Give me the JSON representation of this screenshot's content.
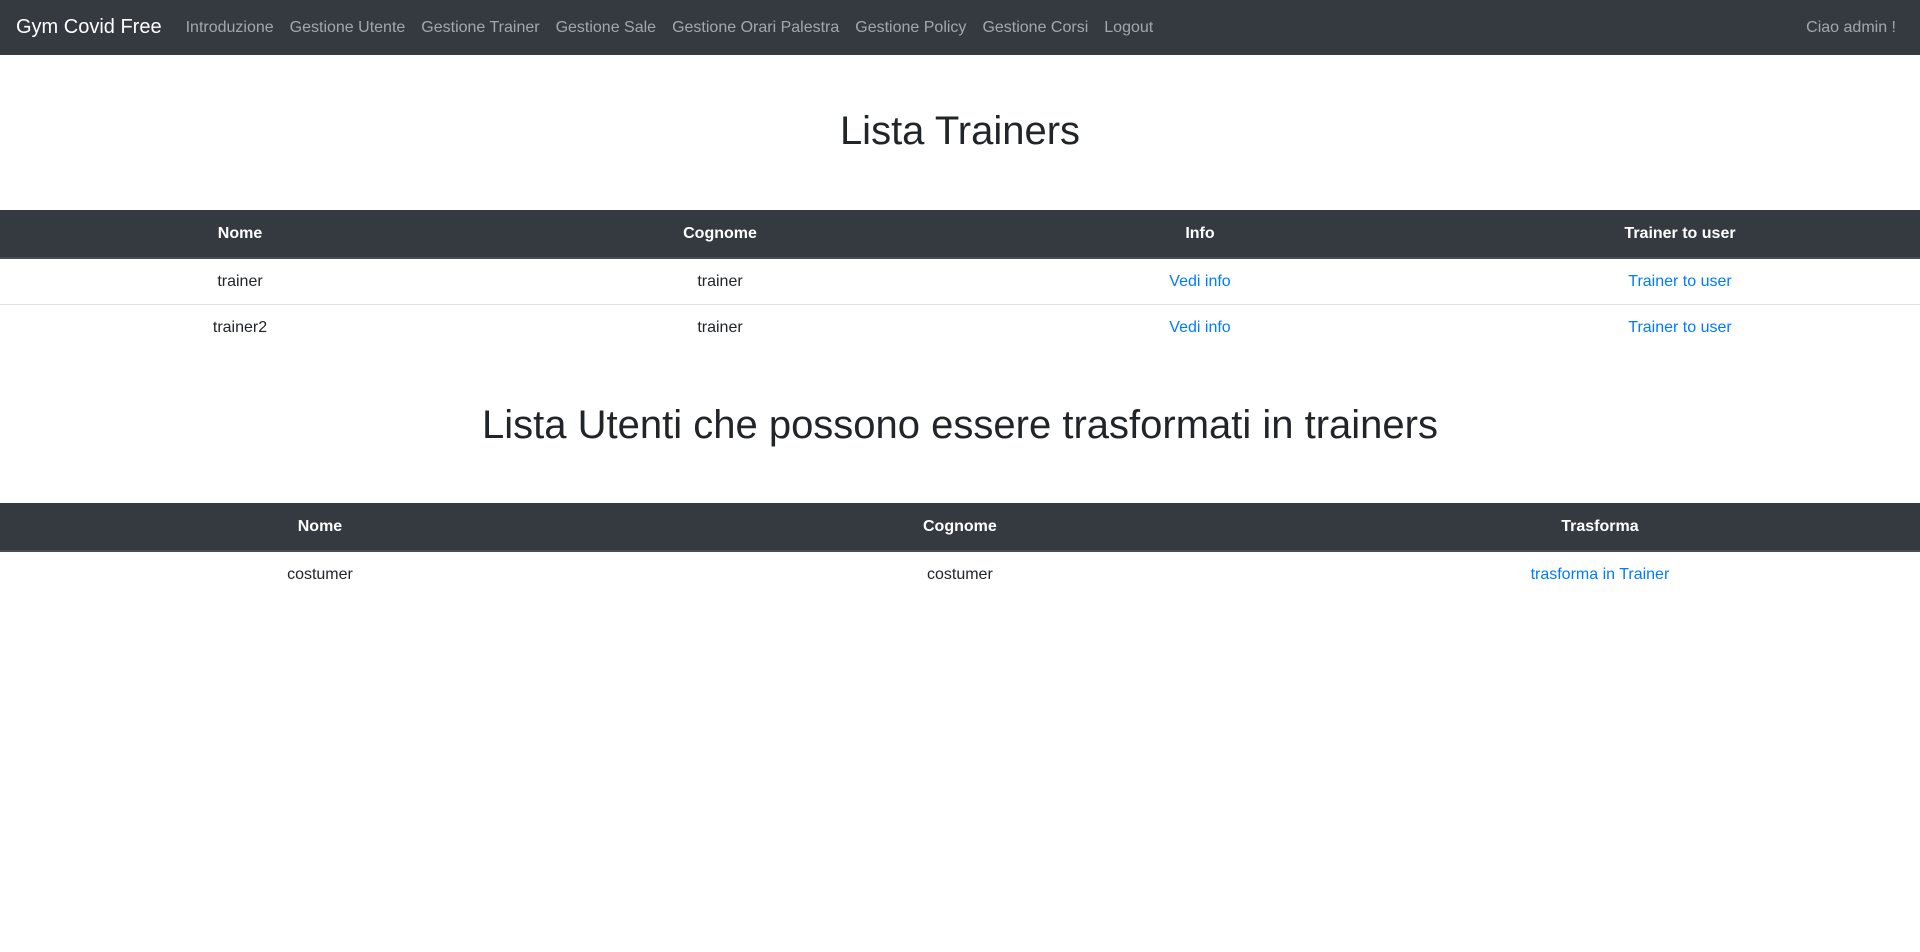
{
  "navbar": {
    "brand": "Gym Covid Free",
    "items": [
      {
        "label": "Introduzione"
      },
      {
        "label": "Gestione Utente"
      },
      {
        "label": "Gestione Trainer"
      },
      {
        "label": "Gestione Sale"
      },
      {
        "label": "Gestione Orari Palestra"
      },
      {
        "label": "Gestione Policy"
      },
      {
        "label": "Gestione Corsi"
      },
      {
        "label": "Logout"
      }
    ],
    "greeting": "Ciao admin !"
  },
  "trainers_section": {
    "title": "Lista Trainers",
    "headers": [
      "Nome",
      "Cognome",
      "Info",
      "Trainer to user"
    ],
    "rows": [
      {
        "nome": "trainer",
        "cognome": "trainer",
        "info": "Vedi info",
        "action": "Trainer to user"
      },
      {
        "nome": "trainer2",
        "cognome": "trainer",
        "info": "Vedi info",
        "action": "Trainer to user"
      }
    ]
  },
  "users_section": {
    "title": "Lista Utenti che possono essere trasformati in trainers",
    "headers": [
      "Nome",
      "Cognome",
      "Trasforma"
    ],
    "rows": [
      {
        "nome": "costumer",
        "cognome": "costumer",
        "action": "trasforma in Trainer"
      }
    ]
  },
  "colors": {
    "navbar_bg": "#343a40",
    "link": "#007bff"
  }
}
